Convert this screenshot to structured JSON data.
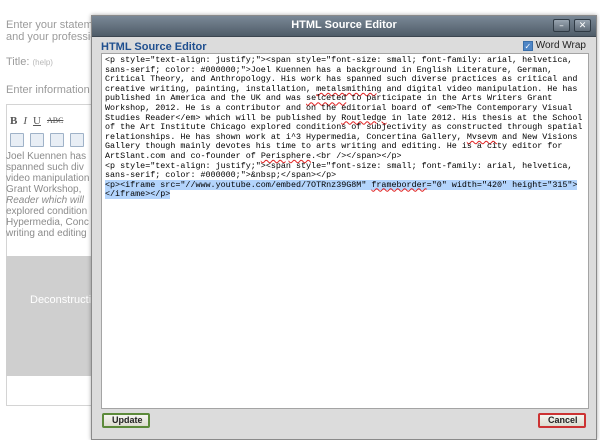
{
  "background": {
    "statement_label_1": "Enter your stateme",
    "statement_label_2": "and your professio",
    "title_label": "Title:",
    "title_help": "(help)",
    "info_label": "Enter information ab",
    "toolbar": {
      "bold": "B",
      "italic": "I",
      "underline": "U",
      "strike": "ABC"
    },
    "body_lines": [
      "Joel Kuennen has",
      "spanned such div",
      "video manipulation",
      "Grant Workshop,",
      "Reader which will",
      "explored condition",
      "Hypermedia, Conc",
      "writing and editing"
    ],
    "panel_text": "Deconstructing/F"
  },
  "dialog": {
    "title": "HTML Source Editor",
    "heading": "HTML Source Editor",
    "word_wrap_label": "Word Wrap",
    "word_wrap_checked": true,
    "update_label": "Update",
    "cancel_label": "Cancel",
    "source_lines": [
      "<p style=\"text-align: justify;\"><span style=\"font-size: small; font-family: arial, helvetica, sans-serif; color: #000000;\">Joel Kuennen has a background in English Literature, German, Critical Theory, and Anthropology. His work has spanned such diverse practices as critical and creative writing, painting, installation, metalsmithing and digital video manipulation. He has published in America and the UK and was selceted to participate in the Arts Writers Grant Workshop, 2012. He is a contributor and on the editorial board of <em>The Contemporary Visual Studies Reader</em> which will be published by Routledge in late 2012. His thesis at the School of the Art Institute Chicago explored conditions of subjectivity as constructed through spatial relationships. He has shown work at i^3 Hypermedia, Concertina Gallery, Mvsevm and New Visions Gallery though mainly devotes his time to arts writing and editing. He is a city editor for ArtSlant.com and co-founder of Perisphere.<br /></span></p>",
      "<p style=\"text-align: justify;\"><span style=\"font-size: small; font-family: arial, helvetica, sans-serif; color: #000000;\">&nbsp;</span></p>",
      "<p><iframe src=\"//www.youtube.com/embed/7OTRnz39G8M\" frameborder=\"0\" width=\"420\" height=\"315\"></iframe></p>"
    ]
  }
}
